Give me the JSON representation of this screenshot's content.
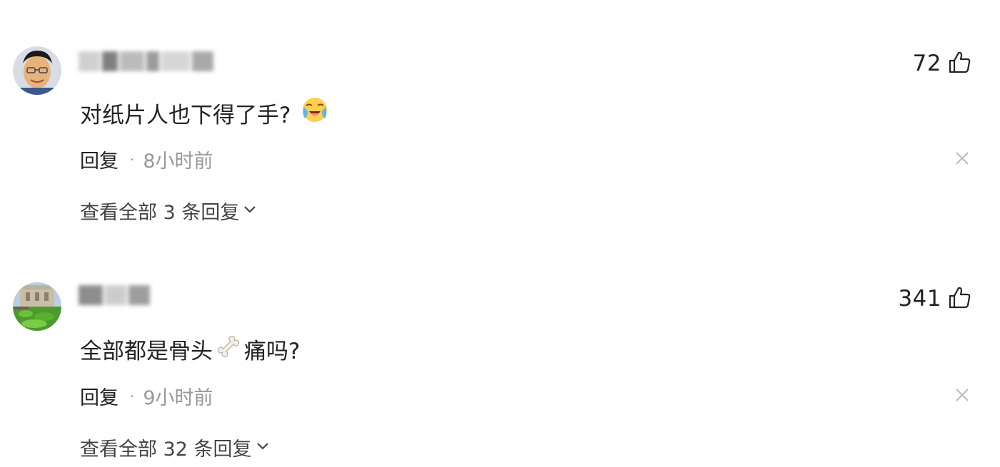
{
  "comments": [
    {
      "like_count": "72",
      "text": "对纸片人也下得了手?",
      "emoji": "loudly-crying-face",
      "reply_label": "回复",
      "separator": "·",
      "time": "8小时前",
      "view_all": "查看全部 3 条回复",
      "icons": [
        "thumbs-up-icon",
        "close-icon",
        "chevron-down-icon"
      ]
    },
    {
      "like_count": "341",
      "text_before": "全部都是骨头",
      "emoji": "bone",
      "text_after": "痛吗?",
      "reply_label": "回复",
      "separator": "·",
      "time": "9小时前",
      "view_all": "查看全部 32 条回复",
      "icons": [
        "thumbs-up-icon",
        "close-icon",
        "chevron-down-icon"
      ]
    }
  ],
  "colors": {
    "text_primary": "#222222",
    "text_secondary": "#999999",
    "text_link": "#444444",
    "close_icon": "#bbbbbb",
    "background": "#ffffff"
  }
}
